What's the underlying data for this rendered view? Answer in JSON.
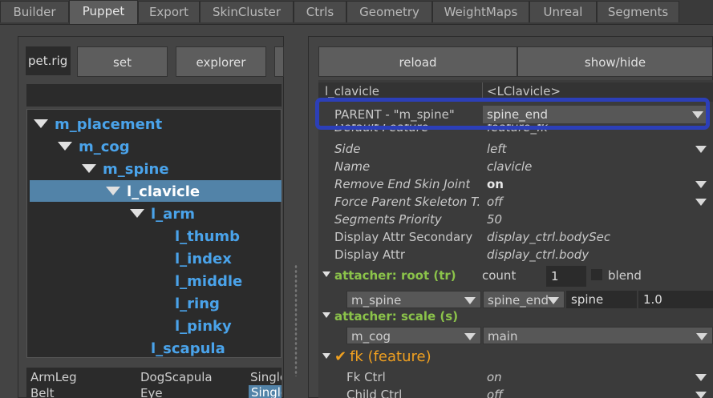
{
  "tabs": [
    "Builder",
    "Puppet",
    "Export",
    "SkinCluster",
    "Ctrls",
    "Geometry",
    "WeightMaps",
    "Unreal",
    "Segments"
  ],
  "active_tab": "Puppet",
  "left": {
    "rig_field": "pet.rig",
    "set_label": "set",
    "explorer_label": "explorer",
    "tree": [
      "m_placement",
      "m_cog",
      "m_spine",
      "l_clavicle",
      "l_arm",
      "l_thumb",
      "l_index",
      "l_middle",
      "l_ring",
      "l_pinky",
      "l_scapula"
    ],
    "list": [
      [
        "ArmLeg",
        "DogScapula",
        "Single"
      ],
      [
        "Belt",
        "Eye",
        "Single"
      ]
    ]
  },
  "right": {
    "reload_label": "reload",
    "showhide_label": "show/hide",
    "header_name": "l_clavicle",
    "header_value": "<LClavicle>",
    "parent_label": "PARENT - \"m_spine\"",
    "parent_value": "spine_end",
    "hidden_label": "Default Feature",
    "hidden_value": "feature_fk",
    "attrs": [
      {
        "label": "Side",
        "value": "left",
        "dropdown": true
      },
      {
        "label": "Name",
        "value": "clavicle",
        "dropdown": false
      },
      {
        "label": "Remove End Skin Joint",
        "value": "on",
        "dropdown": true
      },
      {
        "label": "Force Parent Skeleton T...",
        "value": "off",
        "dropdown": true
      },
      {
        "label": "Segments Priority",
        "value": "50",
        "dropdown": false
      },
      {
        "label": "Display Attr Secondary",
        "value": "display_ctrl.bodySec",
        "dropdown": false
      },
      {
        "label": "Display Attr",
        "value": "display_ctrl.body",
        "dropdown": false
      }
    ],
    "attacher_root": {
      "title": "attacher: root (tr)",
      "count_label": "count",
      "count_value": "1",
      "blend_label": "blend",
      "combo1": "m_spine",
      "combo2": "spine_end",
      "field1": "spine",
      "field2": "1.0"
    },
    "attacher_scale": {
      "title": "attacher: scale (s)",
      "combo1": "m_cog",
      "combo2": "main"
    },
    "fk": {
      "title": "fk (feature)",
      "check": "✔",
      "rows": [
        {
          "label": "Fk Ctrl",
          "value": "on"
        },
        {
          "label": "Child Ctrl",
          "value": "off"
        }
      ]
    }
  },
  "colors": {
    "accent_blue": "#4aa3ea",
    "section_green": "#8bc34a",
    "fk_orange": "#f0a020",
    "highlight": "#2c3fb8"
  }
}
